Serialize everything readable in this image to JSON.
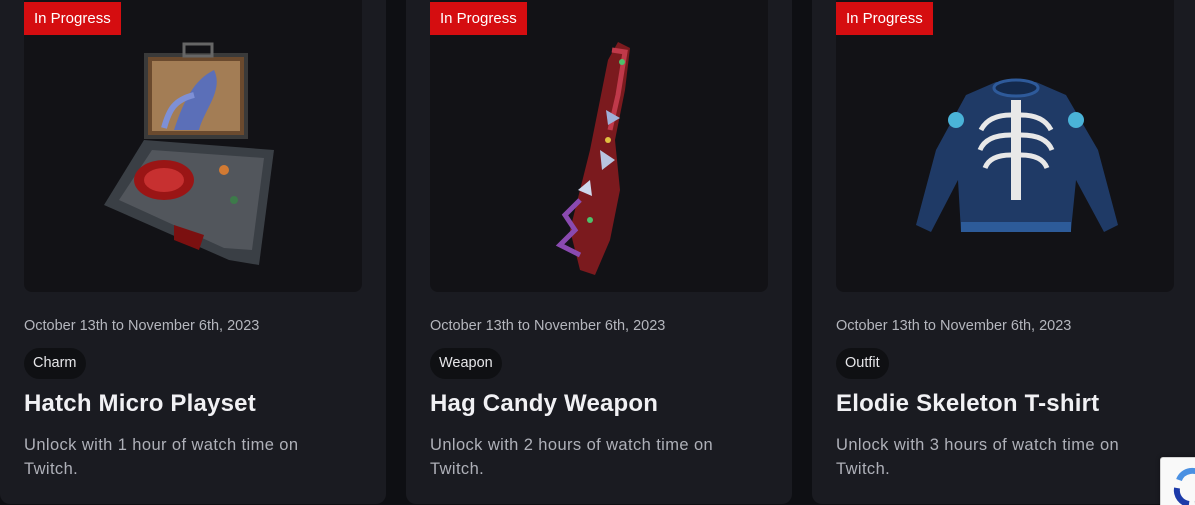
{
  "cards": [
    {
      "status": "In Progress",
      "dates": "October 13th to November 6th, 2023",
      "category": "Charm",
      "title": "Hatch Micro Playset",
      "description": "Unlock with 1 hour of watch time on Twitch.",
      "image": "briefcase-playset-image"
    },
    {
      "status": "In Progress",
      "dates": "October 13th to November 6th, 2023",
      "category": "Weapon",
      "title": "Hag Candy Weapon",
      "description": "Unlock with 2 hours of watch time on Twitch.",
      "image": "candy-claw-weapon-image"
    },
    {
      "status": "In Progress",
      "dates": "October 13th to November 6th, 2023",
      "category": "Outfit",
      "title": "Elodie Skeleton T-shirt",
      "description": "Unlock with 3 hours of watch time on Twitch.",
      "image": "skeleton-sweater-image"
    }
  ],
  "colors": {
    "status_badge": "#d50d10",
    "card_bg": "#1a1b21",
    "page_bg": "#0e0f13"
  },
  "recaptcha_icon": "recaptcha-icon"
}
